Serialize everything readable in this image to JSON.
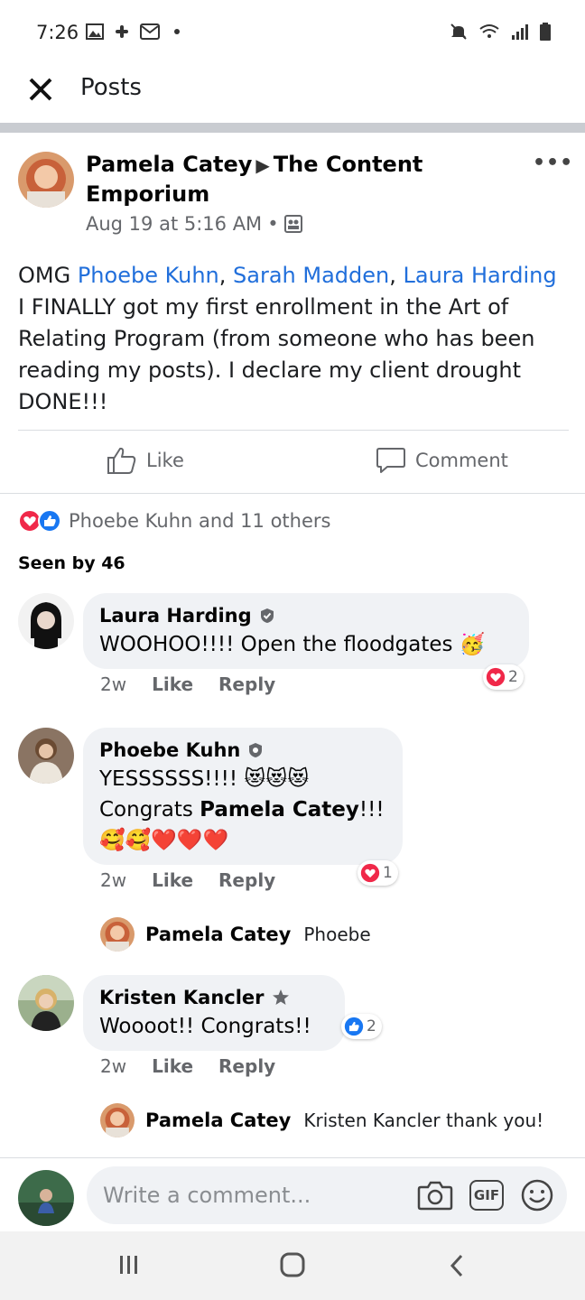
{
  "status_bar": {
    "time": "7:26"
  },
  "header": {
    "title": "Posts"
  },
  "post": {
    "author": "Pamela Catey",
    "group": "The Content Emporium",
    "timestamp": "Aug 19 at 5:16 AM",
    "body": {
      "prefix": "OMG ",
      "mentions": [
        "Phoebe Kuhn",
        "Sarah Madden",
        "Laura Harding"
      ],
      "separator": ", ",
      "text": " I FINALLY got my first enrollment in the Art of Relating Program (from someone who has been reading my posts). I declare my client drought DONE!!!"
    },
    "actions": {
      "like": "Like",
      "comment": "Comment"
    },
    "reactions_summary": "Phoebe Kuhn and 11 others",
    "seen_by": "Seen by 46"
  },
  "comments": [
    {
      "name": "Laura Harding",
      "text": "WOOHOO!!!! Open the floodgates",
      "emoji": "🥳",
      "time": "2w",
      "like": "Like",
      "reply": "Reply",
      "reaction_count": "2"
    },
    {
      "name": "Phoebe Kuhn",
      "line1": "YESSSSSS!!!! ",
      "line1_emoji": "😻😻😻",
      "line2_prefix": "Congrats ",
      "line2_bold": "Pamela Catey",
      "line2_suffix": "!!!",
      "line3_emoji": "🥰🥰❤️❤️❤️",
      "time": "2w",
      "like": "Like",
      "reply": "Reply",
      "reaction_count": "1",
      "reply_item": {
        "name": "Pamela Catey",
        "text": "Phoebe"
      }
    },
    {
      "name": "Kristen Kancler",
      "text": "Woooot!! Congrats!!",
      "time": "2w",
      "like": "Like",
      "reply": "Reply",
      "reaction_count": "2",
      "reply_item": {
        "name": "Pamela Catey",
        "text": "Kristen Kancler thank you!"
      }
    }
  ],
  "composer": {
    "placeholder": "Write a comment...",
    "gif_label": "GIF"
  },
  "colors": {
    "link": "#216fdb",
    "like_blue": "#1877f2",
    "love_red": "#f02849",
    "bubble": "#f0f2f5",
    "muted": "#65676b"
  },
  "icons": [
    "image-icon",
    "slack-icon",
    "gmail-icon",
    "mute-icon",
    "wifi-icon",
    "signal-icon",
    "battery-icon",
    "close-icon",
    "more-icon",
    "group-icon",
    "thumbs-up-icon",
    "comment-icon",
    "love-reaction-icon",
    "like-reaction-icon",
    "verified-badge-icon",
    "star-badge-icon",
    "camera-icon",
    "gif-icon",
    "emoji-icon",
    "recent-apps-icon",
    "home-icon",
    "back-icon"
  ]
}
